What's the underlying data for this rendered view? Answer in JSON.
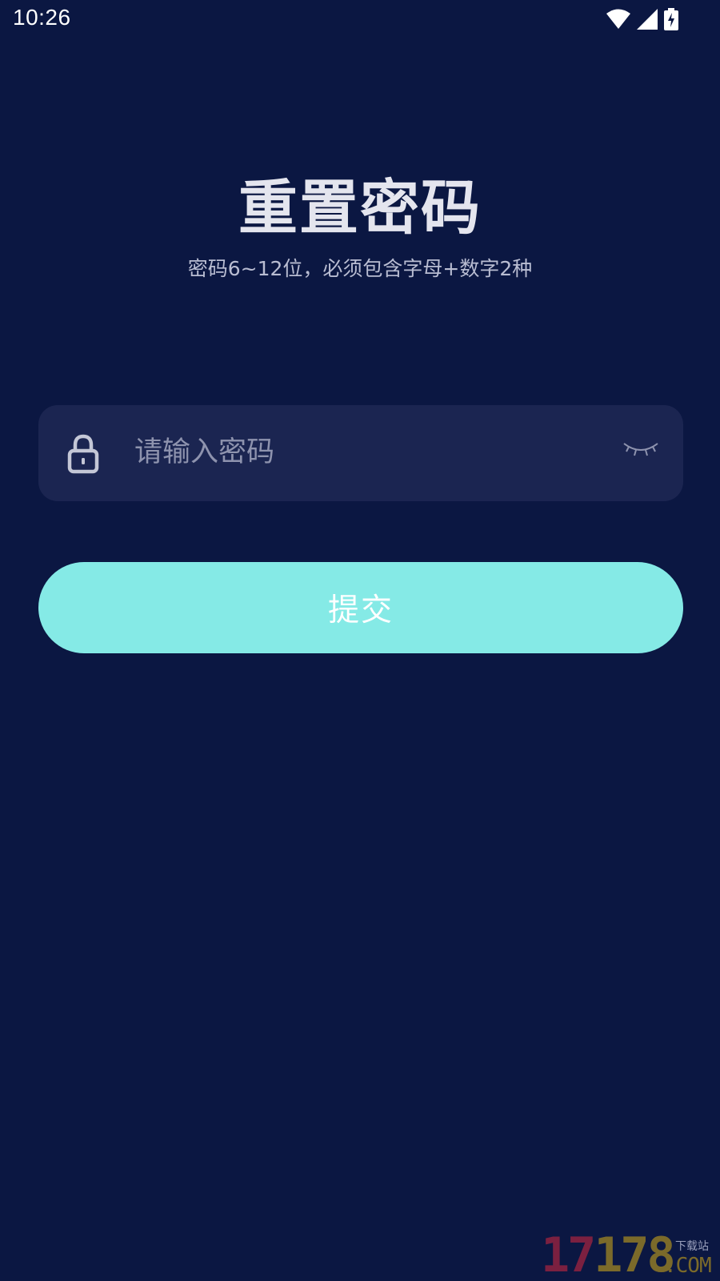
{
  "status_bar": {
    "time": "10:26",
    "icons": [
      "wifi-icon",
      "cell-signal-icon",
      "battery-charging-icon"
    ]
  },
  "header": {
    "title": "重置密码",
    "subtitle": "密码6~12位，必须包含字母+数字2种"
  },
  "password_field": {
    "placeholder": "请输入密码",
    "value": "",
    "lock_icon": "lock-icon",
    "visibility_icon": "eye-closed-icon"
  },
  "submit": {
    "label": "提交"
  },
  "watermark": {
    "digits": "17178",
    "tag": "下载站",
    "domain": ".COM"
  },
  "colors": {
    "background": "#0B1742",
    "field_background": "#1B2551",
    "accent": "#85EAE6",
    "title_text": "#E4E5EE",
    "subtitle_text": "#B9BDD2",
    "placeholder_text": "#8E93AE"
  }
}
